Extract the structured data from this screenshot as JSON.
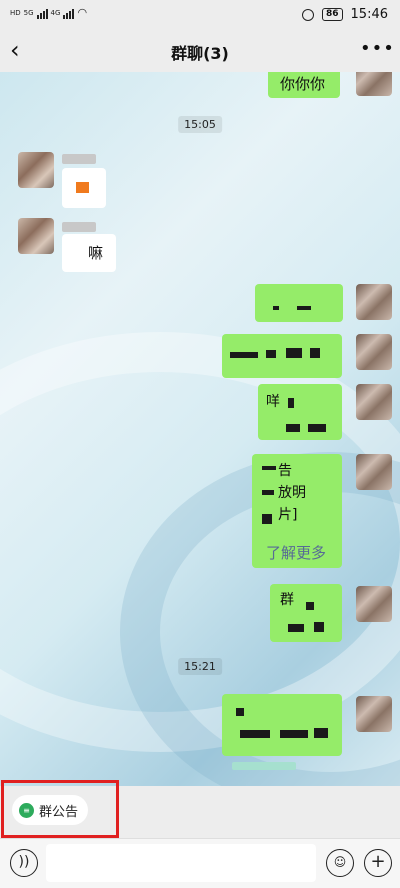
{
  "status_bar": {
    "left_labels": [
      "HD",
      "5G",
      "4G"
    ],
    "battery": "86",
    "time": "15:46"
  },
  "header": {
    "back_icon": "chevron-left-icon",
    "title": "群聊(3)",
    "more_icon": "more-dots-icon"
  },
  "messages": {
    "top_outgoing": "你你你",
    "timestamp_1": "15:05",
    "incoming_2_text": "嘛",
    "outgoing_3_line1": "咩",
    "outgoing_4_link": "了解更多",
    "outgoing_4_line1": "告",
    "outgoing_4_line2": "放明",
    "outgoing_4_line3": "片]",
    "outgoing_5_text": "群",
    "timestamp_2": "15:21"
  },
  "announcement": {
    "icon": "announcement-icon",
    "label": "群公告"
  },
  "input_bar": {
    "voice_icon": "voice-icon",
    "emoji_icon": "emoji-icon",
    "plus_icon": "plus-icon",
    "placeholder": ""
  },
  "colors": {
    "outgoing_bubble": "#95ec69",
    "incoming_bubble": "#ffffff",
    "highlight": "#e02020",
    "announcement_icon": "#2dab5c"
  }
}
